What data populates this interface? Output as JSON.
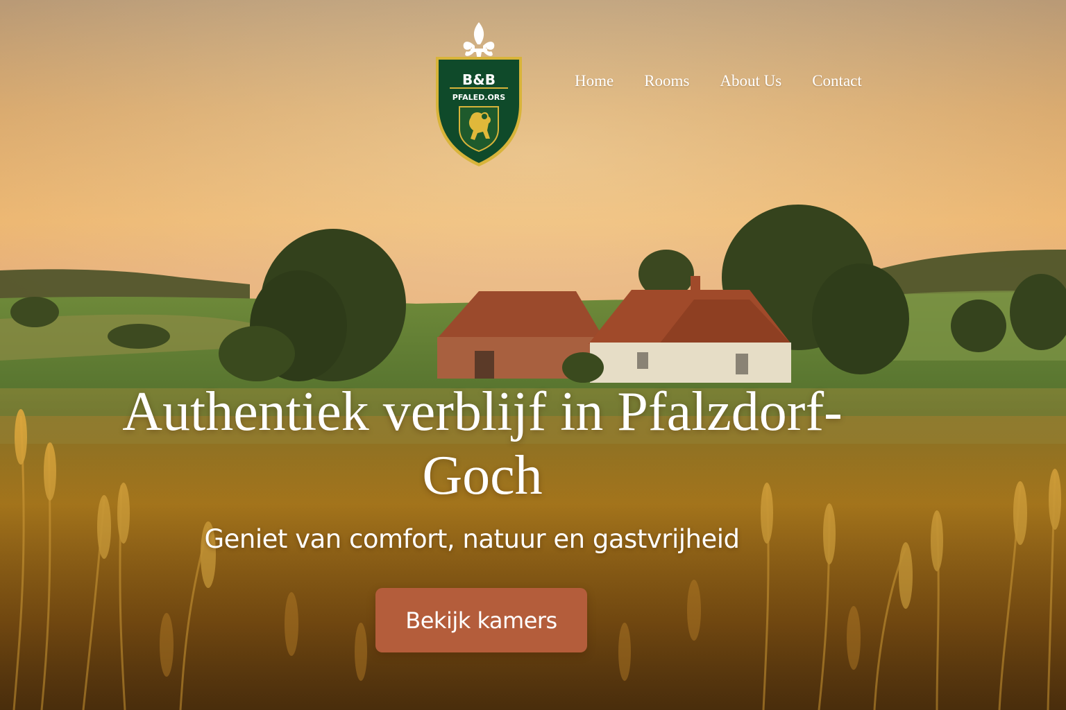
{
  "brand": {
    "line1": "B&B",
    "line2": "PFALED.ORS",
    "shield_color": "#0f4a2a",
    "trim_color": "#d8b43a"
  },
  "nav": {
    "items": [
      {
        "label": "Home"
      },
      {
        "label": "Rooms"
      },
      {
        "label": "About Us"
      },
      {
        "label": "Contact"
      }
    ]
  },
  "hero": {
    "title": "Authentiek verblijf in Pfalzdorf-Goch",
    "subtitle": "Geniet van comfort, natuur en gastvrijheid",
    "cta_label": "Bekijk kamers",
    "cta_color": "#b45d3b"
  }
}
